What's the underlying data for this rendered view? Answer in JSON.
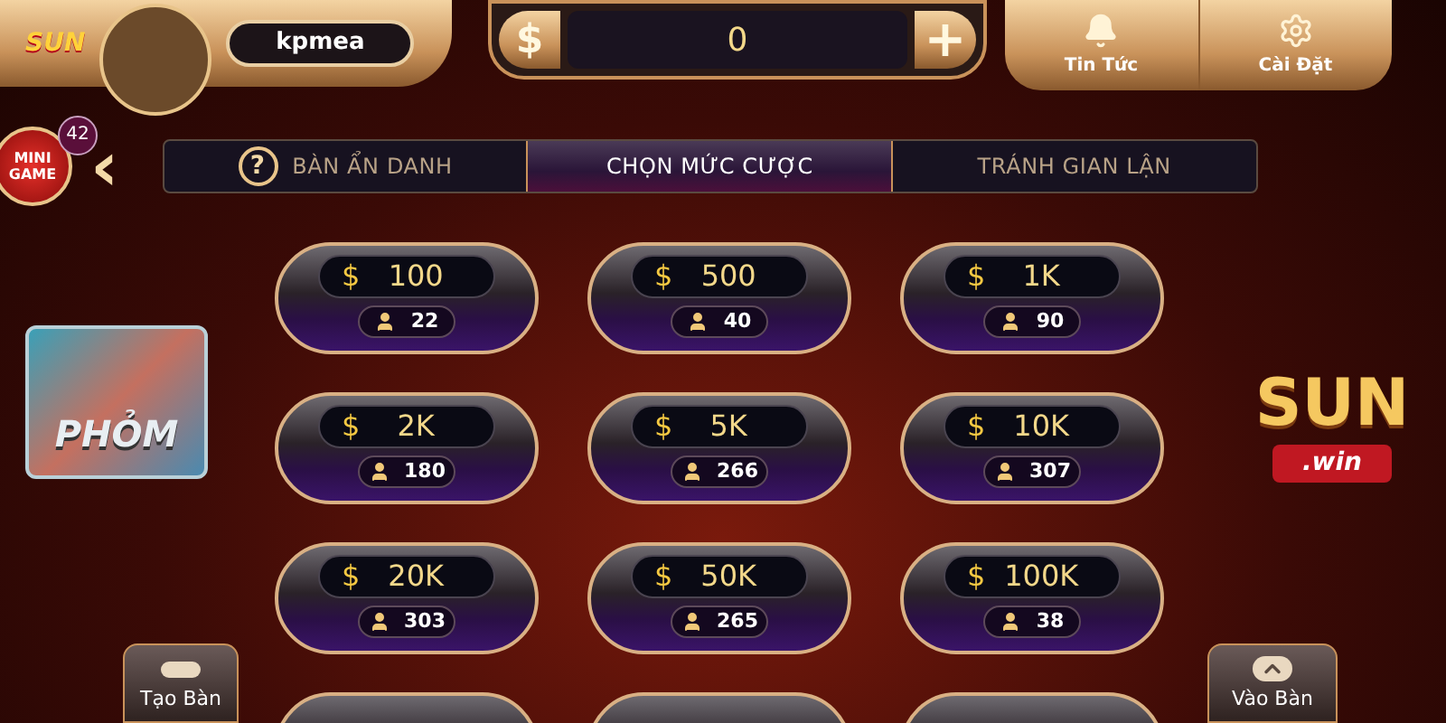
{
  "header": {
    "logo": "SUN",
    "username": "kpmea",
    "balance": {
      "symbol": "$",
      "value": "0",
      "add": "+"
    },
    "buttons": [
      {
        "kind": "bell",
        "label": "Tin Tức"
      },
      {
        "kind": "gear",
        "label": "Cài Đặt"
      }
    ]
  },
  "mini_game": {
    "label_line1": "MINI",
    "label_line2": "GAME",
    "badge": "42"
  },
  "back": "‹",
  "tabs": [
    {
      "label": "BÀN ẨN DANH",
      "help": "?",
      "selected": false
    },
    {
      "label": "CHỌN MỨC CƯỢC",
      "selected": true
    },
    {
      "label": "TRÁNH GIAN LẬN",
      "selected": false
    }
  ],
  "bets": [
    {
      "currency": "$",
      "amount": "100",
      "players": "22"
    },
    {
      "currency": "$",
      "amount": "500",
      "players": "40"
    },
    {
      "currency": "$",
      "amount": "1K",
      "players": "90"
    },
    {
      "currency": "$",
      "amount": "2K",
      "players": "180"
    },
    {
      "currency": "$",
      "amount": "5K",
      "players": "266"
    },
    {
      "currency": "$",
      "amount": "10K",
      "players": "307"
    },
    {
      "currency": "$",
      "amount": "20K",
      "players": "303"
    },
    {
      "currency": "$",
      "amount": "50K",
      "players": "265"
    },
    {
      "currency": "$",
      "amount": "100K",
      "players": "38"
    }
  ],
  "game_tile": {
    "label": "PHỎM"
  },
  "brand_logo": {
    "word": "SUN",
    "sub": ".win"
  },
  "create_table": "Tạo Bàn",
  "join_table": "Vào Bàn"
}
